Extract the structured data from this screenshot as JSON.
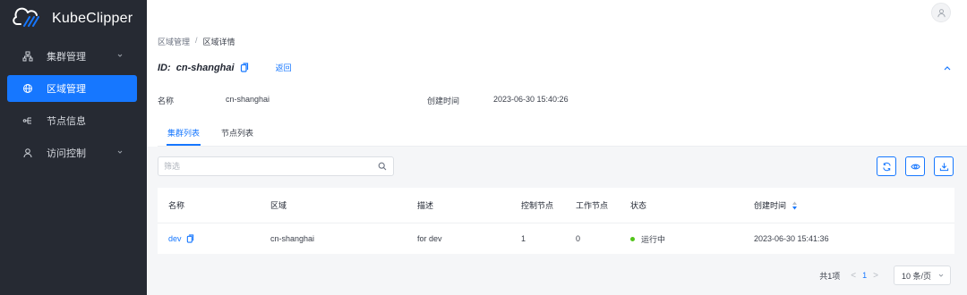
{
  "app": {
    "name": "KubeClipper"
  },
  "sidebar": {
    "items": [
      {
        "label": "集群管理",
        "icon": "cluster-icon",
        "expandable": true
      },
      {
        "label": "区域管理",
        "icon": "globe-icon",
        "active": true
      },
      {
        "label": "节点信息",
        "icon": "node-icon"
      },
      {
        "label": "访问控制",
        "icon": "user-icon",
        "expandable": true
      }
    ]
  },
  "breadcrumb": {
    "parent": "区域管理",
    "separator": "/",
    "current": "区域详情"
  },
  "detail": {
    "id_text": "ID:  cn-shanghai",
    "back_label": "返回",
    "name_key": "名称",
    "name_value": "cn-shanghai",
    "created_key": "创建时间",
    "created_value": "2023-06-30 15:40:26"
  },
  "tabs": [
    {
      "label": "集群列表",
      "active": true
    },
    {
      "label": "节点列表"
    }
  ],
  "search": {
    "placeholder": "筛选",
    "value": ""
  },
  "table": {
    "columns": [
      "名称",
      "区域",
      "描述",
      "控制节点",
      "工作节点",
      "状态",
      "创建时间"
    ],
    "rows": [
      {
        "name": "dev",
        "region": "cn-shanghai",
        "desc": "for dev",
        "control": "1",
        "worker": "0",
        "status": "运行中",
        "created": "2023-06-30 15:41:36"
      }
    ]
  },
  "pagination": {
    "total_text": "共1项",
    "current_page": "1",
    "page_size": "10 条/页"
  },
  "colors": {
    "accent": "#1677ff",
    "sidebar_bg": "#262a33",
    "status_running": "#52c41a"
  }
}
